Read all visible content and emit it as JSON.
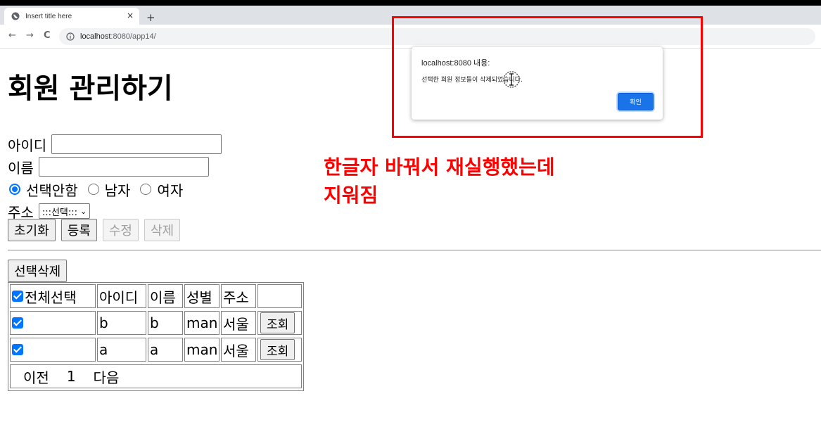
{
  "browser": {
    "tab_title": "Insert title here",
    "tab_close": "×",
    "new_tab": "+",
    "url_host": "localhost",
    "url_path": ":8080/app14/",
    "nav": {
      "back": "←",
      "forward": "→",
      "reload": "C"
    }
  },
  "page": {
    "title": "회원 관리하기",
    "form": {
      "id_label": "아이디",
      "id_value": "",
      "name_label": "이름",
      "name_value": "",
      "gender_options": [
        {
          "label": "선택안함",
          "checked": true
        },
        {
          "label": "남자",
          "checked": false
        },
        {
          "label": "여자",
          "checked": false
        }
      ],
      "address_label": "주소",
      "address_selected": ":::선택:::",
      "buttons": {
        "reset": "초기화",
        "register": "등록",
        "edit": "수정",
        "delete": "삭제"
      }
    },
    "delete_selected_button": "선택삭제",
    "table": {
      "headers": {
        "select_all": "전체선택",
        "id": "아이디",
        "name": "이름",
        "gender": "성별",
        "address": "주소"
      },
      "rows": [
        {
          "checked": true,
          "id": "b",
          "name": "b",
          "gender": "man",
          "address": "서울",
          "action": "조회"
        },
        {
          "checked": true,
          "id": "a",
          "name": "a",
          "gender": "man",
          "address": "서울",
          "action": "조회"
        }
      ],
      "pager": {
        "prev": "이전",
        "page": "1",
        "next": "다음"
      }
    }
  },
  "alert": {
    "title": "localhost:8080 내용:",
    "message": "선택한 회원 정보들이 삭제되었습니다.",
    "ok_button": "확인"
  },
  "annotation": {
    "line1": "한글자 바꿔서 재실행했는데",
    "line2": "지워짐",
    "color": "#ff0000"
  }
}
